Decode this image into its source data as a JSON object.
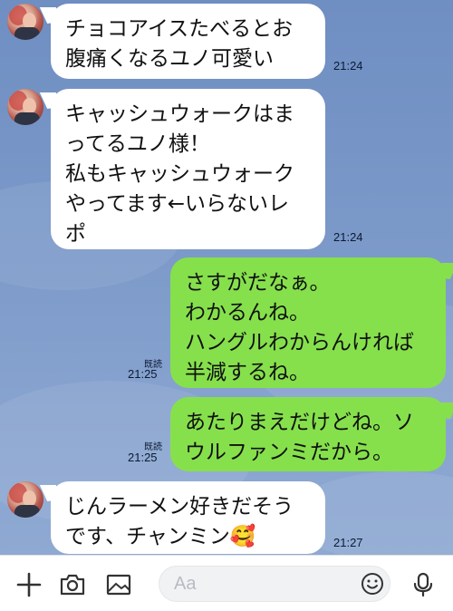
{
  "messages": [
    {
      "side": "in",
      "text": "チョコアイスたべるとお\n腹痛くなるユノ可愛い",
      "time": "21:24"
    },
    {
      "side": "in",
      "text": "キャッシュウォークはま\nってるユノ様！\n私もキャッシュウォーク\nやってます←いらないレ\nポ",
      "time": "21:24"
    },
    {
      "side": "out",
      "text": "さすがだなぁ。\nわかるんね。\nハングルわからんければ\n半減するね。",
      "read": "既読",
      "time": "21:25"
    },
    {
      "side": "out",
      "text": "あたりまえだけどね。ソ\nウルファンミだから。",
      "read": "既読",
      "time": "21:25"
    },
    {
      "side": "in",
      "text": "じんラーメン好きだそう\nです、チャンミン🥰",
      "time": "21:27"
    }
  ],
  "toolbar": {
    "input_placeholder": "Aa",
    "icons": [
      "plus-icon",
      "camera-icon",
      "image-icon",
      "emoji-icon",
      "microphone-icon"
    ]
  },
  "colors": {
    "background": "#7f9ac5",
    "incoming_bubble": "#ffffff",
    "outgoing_bubble": "#86e04c"
  }
}
